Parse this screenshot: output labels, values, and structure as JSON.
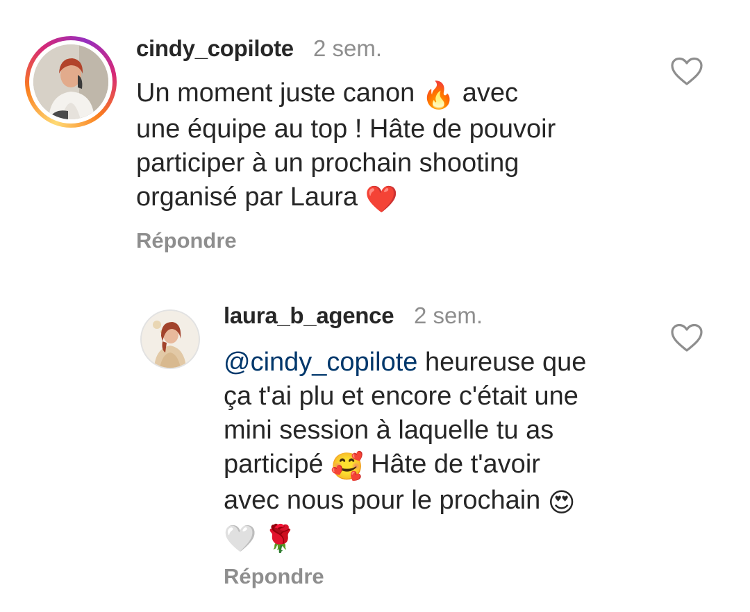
{
  "comments": [
    {
      "username": "cindy_copilote",
      "time": "2 sem.",
      "lines": [
        [
          "Un moment juste canon ",
          "🔥",
          " avec"
        ],
        [
          "une équipe au top ! Hâte de pouvoir"
        ],
        [
          "participer à un prochain shooting"
        ],
        [
          "organisé par Laura ",
          "❤️"
        ]
      ],
      "reply_label": "Répondre"
    },
    {
      "username": "laura_b_agence",
      "time": "2 sem.",
      "mention": "@cindy_copilote",
      "lines_after_mention_first": " heureuse que",
      "lines": [
        [
          "ça t'ai plu et encore c'était une"
        ],
        [
          "mini session à laquelle tu as"
        ],
        [
          "participé ",
          "🥰",
          " Hâte de t'avoir"
        ],
        [
          "avec nous pour le prochain ",
          "😍"
        ],
        [
          "🤍",
          " ",
          "🌹"
        ]
      ],
      "reply_label": "Répondre"
    }
  ],
  "icons": {
    "like": "heart-outline-icon",
    "avatar_ring_colors": [
      "#feda75",
      "#fa7e1e",
      "#d62976",
      "#962fbf"
    ]
  }
}
